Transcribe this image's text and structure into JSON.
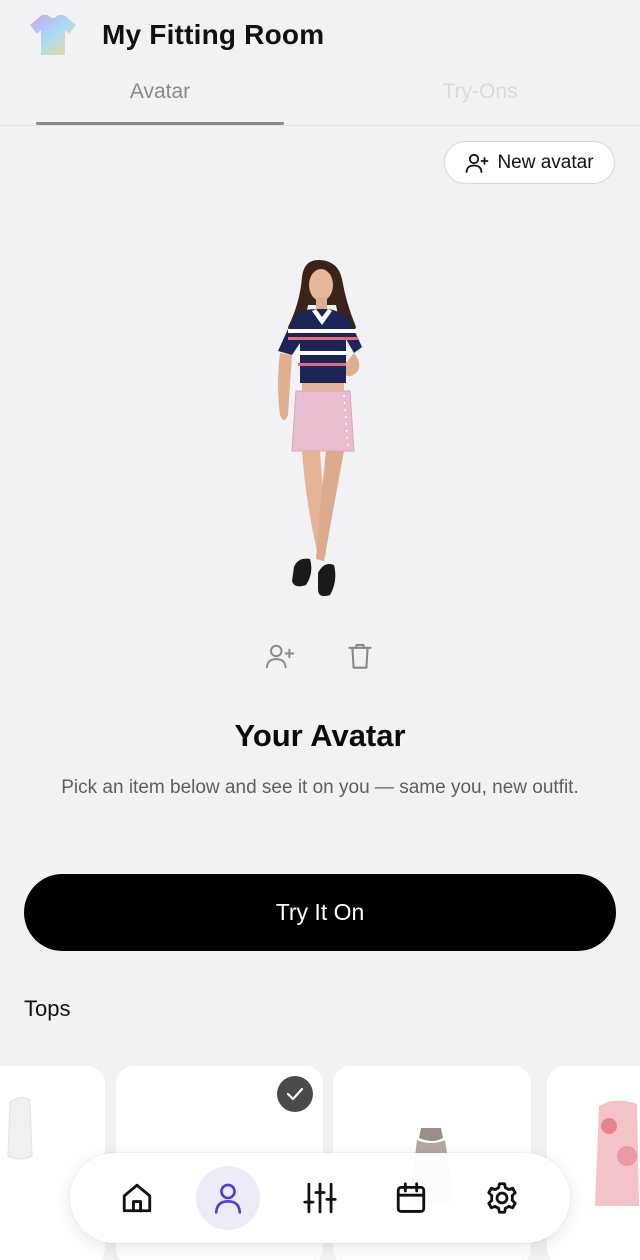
{
  "header": {
    "logo_icon": "tshirt-gradient-icon",
    "title": "My Fitting Room"
  },
  "tabs": [
    {
      "label": "Avatar",
      "active": true
    },
    {
      "label": "Try-Ons",
      "active": false
    }
  ],
  "new_avatar_button": {
    "label": "New avatar",
    "icon": "user-plus-icon"
  },
  "avatar": {
    "image_icon": "avatar-photo",
    "actions": [
      {
        "icon": "user-plus-icon"
      },
      {
        "icon": "trash-icon"
      }
    ],
    "title": "Your Avatar",
    "description": "Pick an item below and see it on you — same you, new outfit."
  },
  "try_button": {
    "label": "Try It On"
  },
  "tops_section": {
    "title": "Tops",
    "items": [
      {
        "icon": "white-top-thumbnail",
        "selected": false
      },
      {
        "icon": "white-top-thumbnail",
        "selected": true
      },
      {
        "icon": "brown-halter-top-thumbnail",
        "selected": false
      },
      {
        "icon": "pink-print-top-thumbnail",
        "selected": false
      }
    ]
  },
  "bottom_nav": {
    "items": [
      {
        "icon": "home-icon",
        "active": false
      },
      {
        "icon": "user-icon",
        "active": true
      },
      {
        "icon": "sliders-icon",
        "active": false
      },
      {
        "icon": "calendar-icon",
        "active": false
      },
      {
        "icon": "gear-icon",
        "active": false
      }
    ]
  },
  "colors": {
    "background": "#f2f2f4",
    "primary_button": "#000000",
    "active_nav_icon": "#4b3fd6",
    "muted_text": "#5e5e62"
  }
}
